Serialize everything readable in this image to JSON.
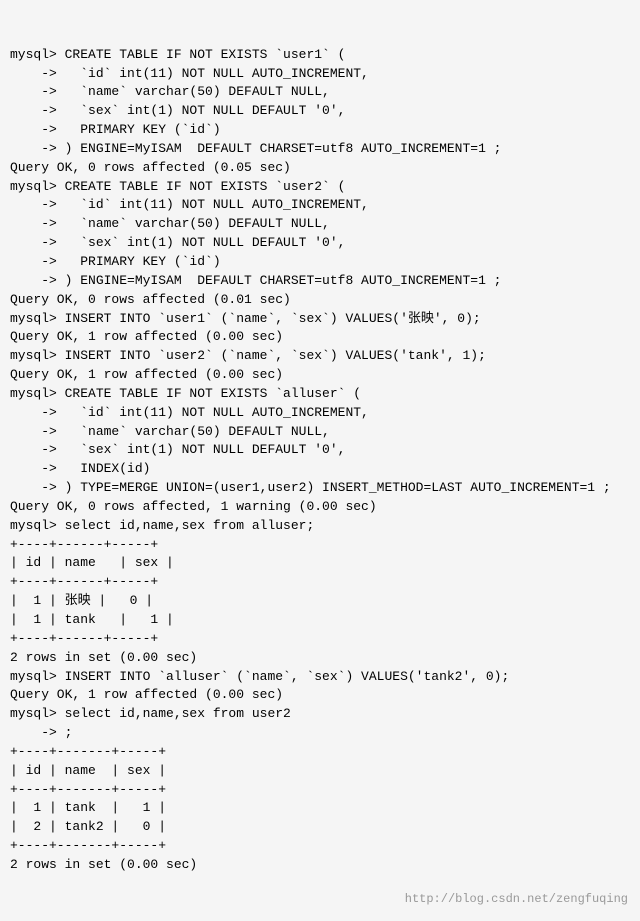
{
  "terminal": {
    "background": "#f5f5f5",
    "watermark": "http://blog.csdn.net/zengfuqing",
    "lines": [
      "mysql> CREATE TABLE IF NOT EXISTS `user1` (",
      "    ->   `id` int(11) NOT NULL AUTO_INCREMENT,",
      "    ->   `name` varchar(50) DEFAULT NULL,",
      "    ->   `sex` int(1) NOT NULL DEFAULT '0',",
      "    ->   PRIMARY KEY (`id`)",
      "    -> ) ENGINE=MyISAM  DEFAULT CHARSET=utf8 AUTO_INCREMENT=1 ;",
      "Query OK, 0 rows affected (0.05 sec)",
      "",
      "mysql> CREATE TABLE IF NOT EXISTS `user2` (",
      "    ->   `id` int(11) NOT NULL AUTO_INCREMENT,",
      "    ->   `name` varchar(50) DEFAULT NULL,",
      "    ->   `sex` int(1) NOT NULL DEFAULT '0',",
      "    ->   PRIMARY KEY (`id`)",
      "    -> ) ENGINE=MyISAM  DEFAULT CHARSET=utf8 AUTO_INCREMENT=1 ;",
      "Query OK, 0 rows affected (0.01 sec)",
      "",
      "mysql> INSERT INTO `user1` (`name`, `sex`) VALUES('张映', 0);",
      "Query OK, 1 row affected (0.00 sec)",
      "",
      "mysql> INSERT INTO `user2` (`name`, `sex`) VALUES('tank', 1);",
      "Query OK, 1 row affected (0.00 sec)",
      "",
      "mysql> CREATE TABLE IF NOT EXISTS `alluser` (",
      "    ->   `id` int(11) NOT NULL AUTO_INCREMENT,",
      "    ->   `name` varchar(50) DEFAULT NULL,",
      "    ->   `sex` int(1) NOT NULL DEFAULT '0',",
      "    ->   INDEX(id)",
      "    -> ) TYPE=MERGE UNION=(user1,user2) INSERT_METHOD=LAST AUTO_INCREMENT=1 ;",
      "Query OK, 0 rows affected, 1 warning (0.00 sec)",
      "",
      "mysql> select id,name,sex from alluser;",
      "+----+------+-----+",
      "| id | name   | sex |",
      "+----+------+-----+",
      "|  1 | 张映 |   0 |",
      "|  1 | tank   |   1 |",
      "+----+------+-----+",
      "2 rows in set (0.00 sec)",
      "",
      "mysql> INSERT INTO `alluser` (`name`, `sex`) VALUES('tank2', 0);",
      "Query OK, 1 row affected (0.00 sec)",
      "",
      "mysql> select id,name,sex from user2",
      "    -> ;",
      "+----+-------+-----+",
      "| id | name  | sex |",
      "+----+-------+-----+",
      "|  1 | tank  |   1 |",
      "|  2 | tank2 |   0 |",
      "+----+-------+-----+",
      "2 rows in set (0.00 sec)"
    ]
  }
}
